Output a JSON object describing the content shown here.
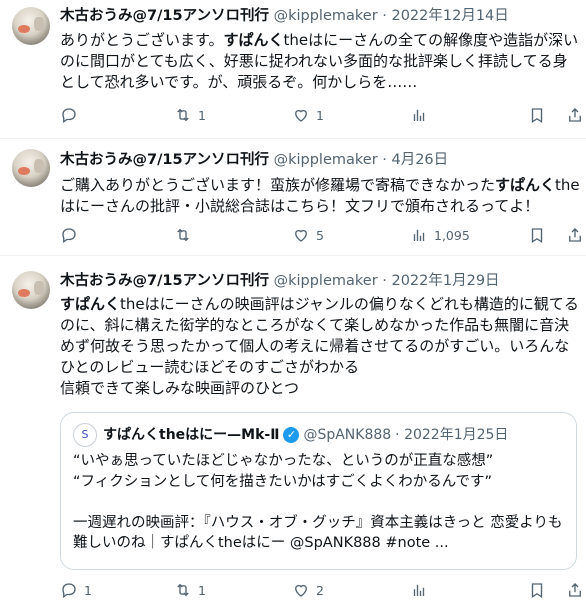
{
  "tweets": [
    {
      "author": "木古おうみ@7/15アンソロ刊行",
      "handle": "@kipplemaker",
      "date": "· 2022年12月14日",
      "text_pre": "ありがとうございます。",
      "text_bold": "すぱんく",
      "text_post": "theはにーさんの全ての解像度や造詣が深いのに間口がとても広く、好悪に捉われない多面的な批評楽しく拝読してる身として恐れ多いです。が、頑張るぞ。何かしらを……",
      "replies": "",
      "retweets": "1",
      "likes": "1",
      "views": ""
    },
    {
      "author": "木古おうみ@7/15アンソロ刊行",
      "handle": "@kipplemaker",
      "date": "· 4月26日",
      "text_pre": "ご購入ありがとうございます！蛮族が修羅場で寄稿できなかった",
      "text_bold": "すぱんく",
      "text_post": "theはにーさんの批評・小説総合誌はこちら！文フリで頒布されるってよ！",
      "replies": "",
      "retweets": "",
      "likes": "5",
      "views": "1,095"
    },
    {
      "author": "木古おうみ@7/15アンソロ刊行",
      "handle": "@kipplemaker",
      "date": "· 2022年1月29日",
      "text_pre": "",
      "text_bold": "すぱんく",
      "text_post": "theはにーさんの映画評はジャンルの偏りなくどれも構造的に観てるのに、斜に構えた衒学的なところがなくて楽しめなかった作品も無闇に音決めず何故そう思ったかって個人の考えに帰着させてるのがすごい。いろんなひとのレビュー読むほどそのすごさがわかる",
      "text_line2": "信頼できて楽しみな映画評のひとつ",
      "replies": "1",
      "retweets": "1",
      "likes": "2",
      "views": ""
    }
  ],
  "quote": {
    "avatar_text": "S",
    "author": "すぱんくtheはにー—Mk-Ⅱ",
    "handle": "@SpANK888",
    "date": "· 2022年1月25日",
    "line1": "“いやぁ思っていたほどじゃなかったな、というのが正直な感想”",
    "line2": "“フィクションとして何を描きたいかはすごくよくわかるんです”",
    "line3": "一週遅れの映画評：『ハウス・オブ・グッチ』資本主義はきっと 恋愛よりも難しいのね｜すぱんくtheはにー @SpANK888 #note ..."
  },
  "colors": {
    "text": "#0f1419",
    "muted": "#536471",
    "border": "#eff3f4",
    "verified": "#1d9bf0"
  },
  "icons": [
    "reply-icon",
    "retweet-icon",
    "like-icon",
    "views-icon",
    "bookmark-icon",
    "share-icon",
    "verified-badge-icon"
  ]
}
